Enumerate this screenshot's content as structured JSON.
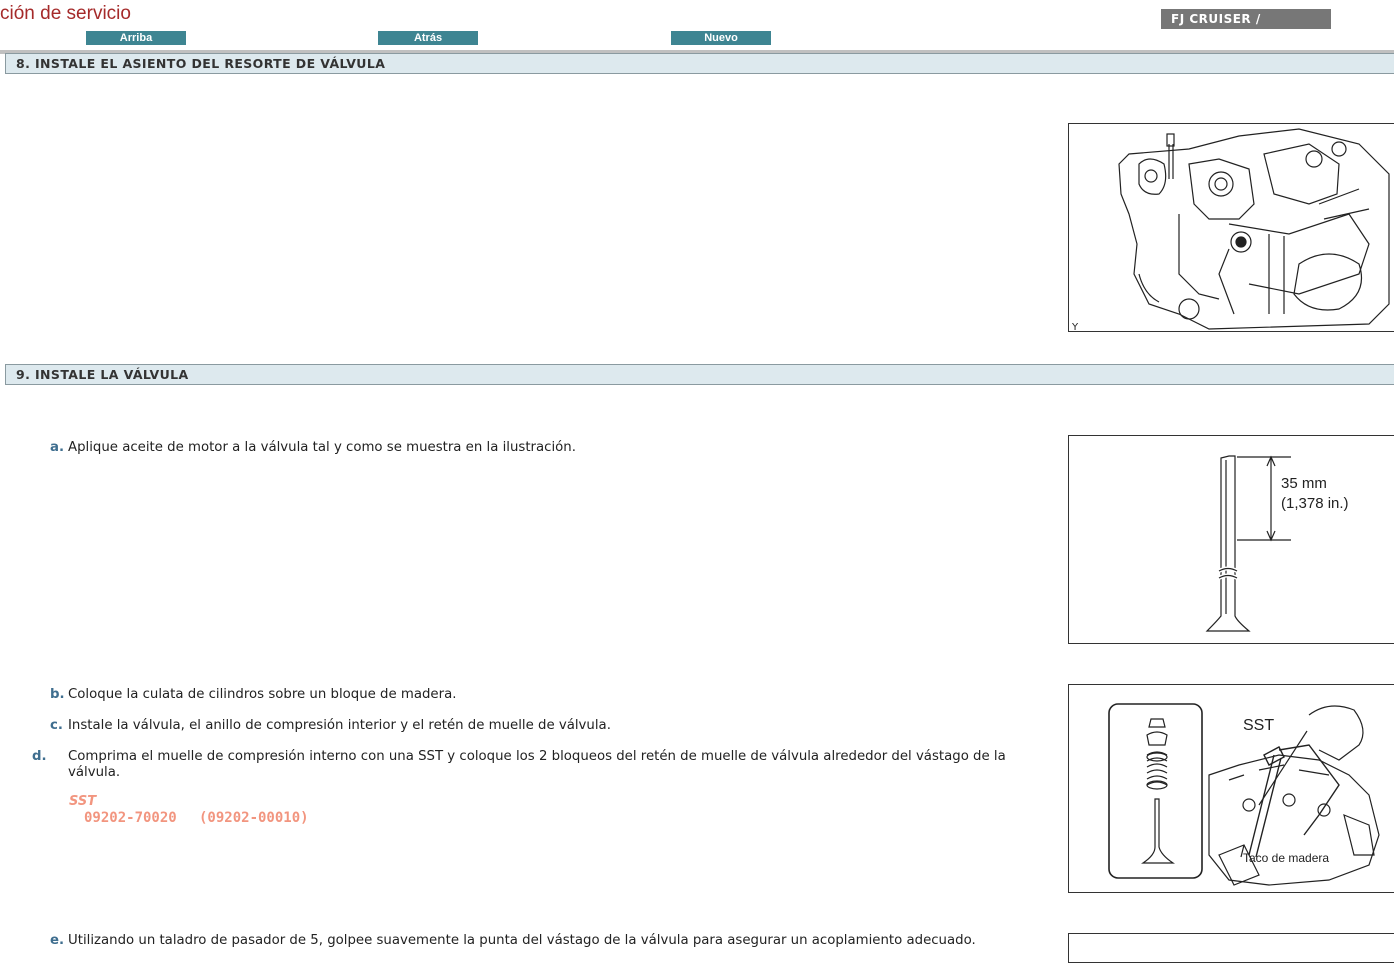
{
  "header": {
    "title": "ción de servicio",
    "model": "FJ CRUISER /",
    "nav": {
      "up": "Arriba",
      "back": "Atrás",
      "new": "Nuevo"
    }
  },
  "sections": [
    {
      "title": "8. INSTALE EL ASIENTO DEL RESORTE DE VÁLVULA"
    },
    {
      "title": "9. INSTALE LA VÁLVULA"
    }
  ],
  "figures": {
    "fig1": {
      "corner_label": "Y"
    },
    "fig2": {
      "dimension_line1": "35 mm",
      "dimension_line2": "(1,378 in.)"
    },
    "fig3": {
      "tool_label": "SST",
      "block_label": "Taco de madera"
    }
  },
  "steps": [
    {
      "letter": "a.",
      "text": "Aplique aceite de motor a la válvula tal y como se muestra en la ilustración."
    },
    {
      "letter": "b.",
      "text": "Coloque la culata de cilindros sobre un bloque de madera."
    },
    {
      "letter": "c.",
      "text": "Instale la válvula, el anillo de compresión interior y el retén de muelle de válvula."
    },
    {
      "letter": "d.",
      "text": "Comprima el muelle de compresión interno con una SST y coloque los 2 bloqueos del retén de muelle de válvula alrededor del vástago de la válvula."
    },
    {
      "letter": "e.",
      "text": "Utilizando un taladro de pasador de 5, golpee suavemente la punta del vástago de la válvula para asegurar un acoplamiento adecuado."
    }
  ],
  "sst": {
    "label": "SST",
    "code": "09202-70020",
    "sub_code": "(09202-00010)"
  },
  "colors": {
    "title_red": "#a52a2a",
    "nav_teal": "#3e8592",
    "section_bg": "#dde9ee",
    "step_letter": "#3f6e8f",
    "sst_salmon": "#f2957f"
  }
}
